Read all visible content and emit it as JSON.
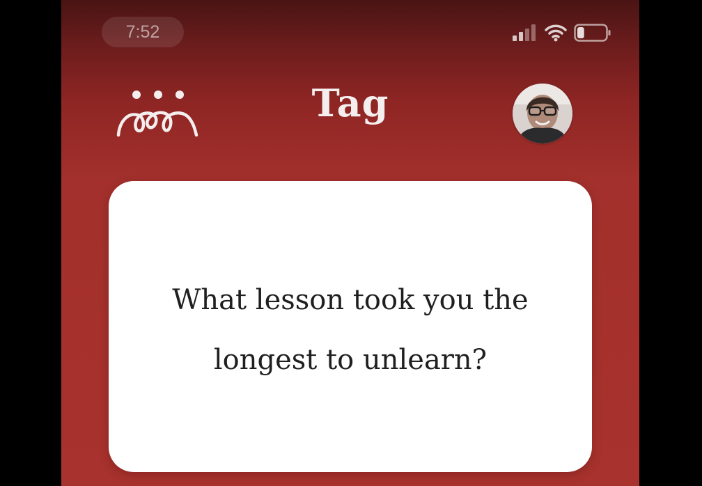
{
  "status_bar": {
    "time": "7:52",
    "icons": [
      "cellular-signal-icon",
      "wifi-icon",
      "battery-icon"
    ],
    "battery_level": 0.25
  },
  "header": {
    "title": "Tag",
    "left_icon": "people-group-icon",
    "right_icon": "profile-avatar"
  },
  "card": {
    "question": "What lesson took you the longest to unlearn?"
  },
  "colors": {
    "background": "#a8322d",
    "card": "#ffffff",
    "text": "#1f1f1f"
  }
}
